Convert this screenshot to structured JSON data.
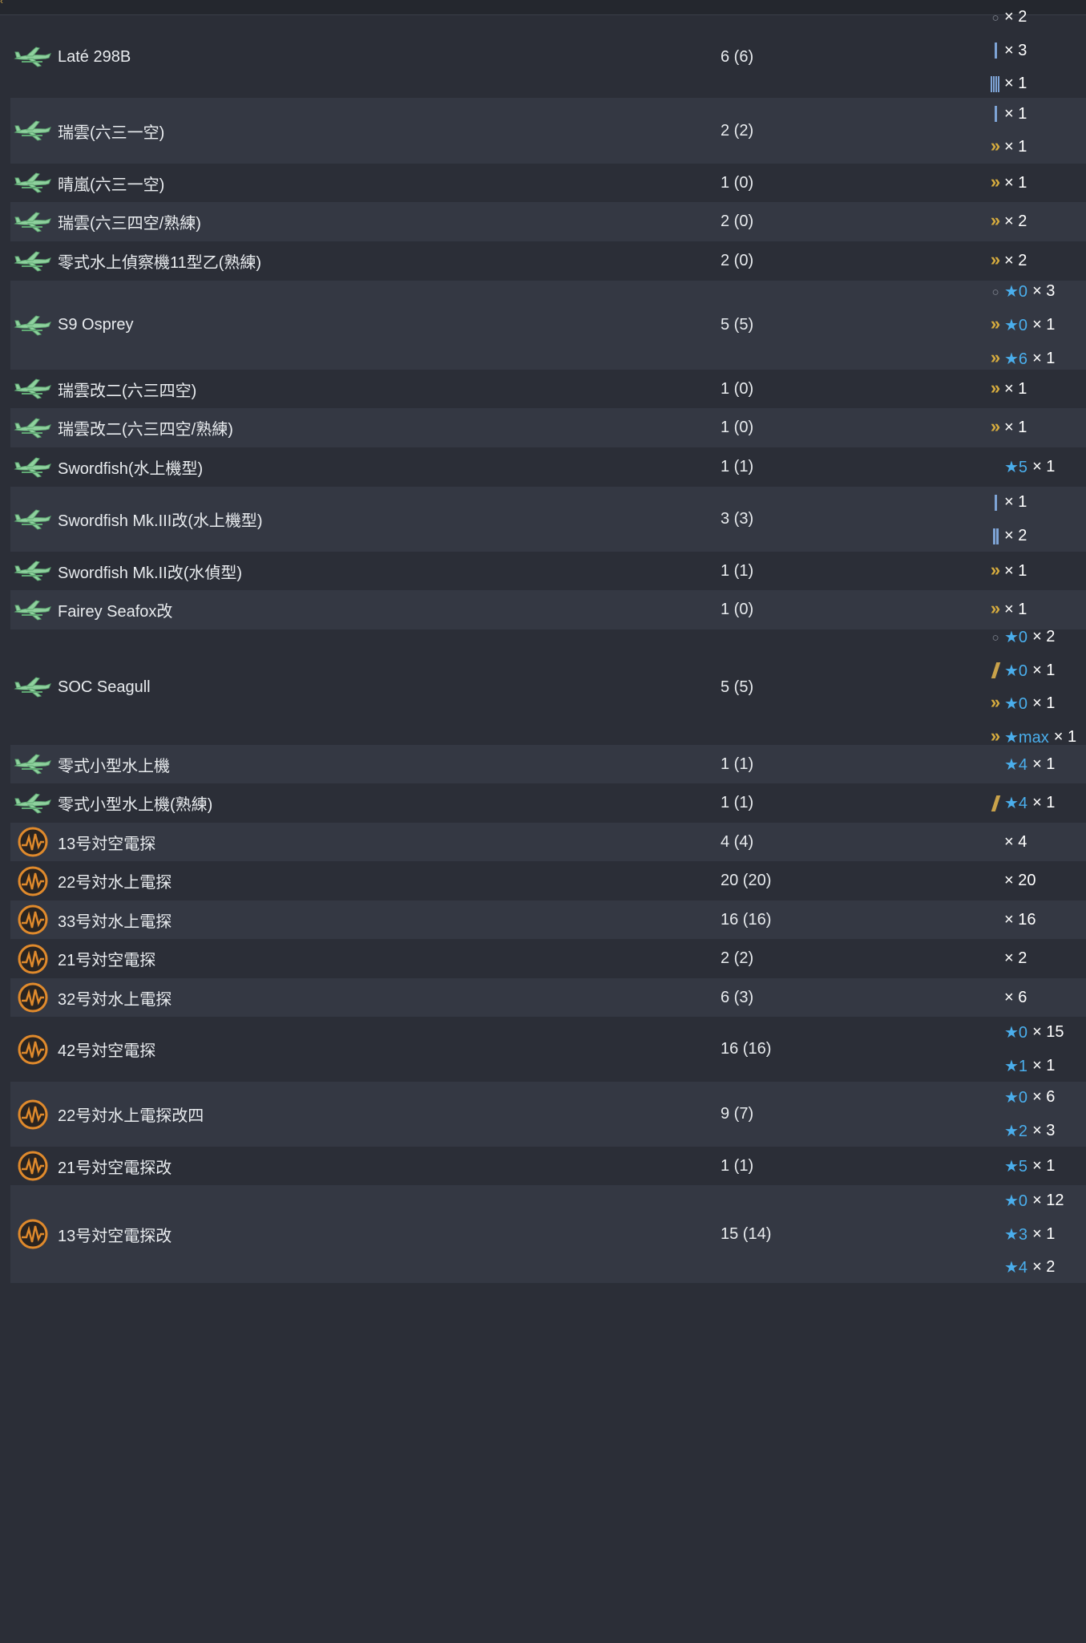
{
  "header": {
    "corner_glyph": "‹"
  },
  "rows": [
    {
      "icon": "seaplane-icon",
      "name": "Laté 298B",
      "count": "6 (6)",
      "height": 0,
      "details": [
        {
          "glyph": "circle",
          "star": "",
          "mult": "× 2"
        },
        {
          "glyph": "bar1",
          "star": "",
          "mult": "× 3"
        },
        {
          "glyph": "bar4",
          "star": "",
          "mult": "× 1"
        }
      ]
    },
    {
      "icon": "seaplane-icon",
      "name": "瑞雲(六三一空)",
      "count": "2 (2)",
      "details": [
        {
          "glyph": "bar1",
          "star": "",
          "mult": "× 1"
        },
        {
          "glyph": "chevron",
          "star": "",
          "mult": "× 1"
        }
      ]
    },
    {
      "icon": "seaplane-icon",
      "name": "晴嵐(六三一空)",
      "count": "1 (0)",
      "details": [
        {
          "glyph": "chevron",
          "star": "",
          "mult": "× 1"
        }
      ]
    },
    {
      "icon": "seaplane-icon",
      "name": "瑞雲(六三四空/熟練)",
      "count": "2 (0)",
      "details": [
        {
          "glyph": "chevron",
          "star": "",
          "mult": "× 2"
        }
      ]
    },
    {
      "icon": "seaplane-icon",
      "name": "零式水上偵察機11型乙(熟練)",
      "count": "2 (0)",
      "details": [
        {
          "glyph": "chevron",
          "star": "",
          "mult": "× 2"
        }
      ]
    },
    {
      "icon": "seaplane-icon",
      "name": "S9 Osprey",
      "count": "5 (5)",
      "details": [
        {
          "glyph": "circle",
          "star": "★0",
          "mult": "× 3"
        },
        {
          "glyph": "chevron",
          "star": "★0",
          "mult": "× 1"
        },
        {
          "glyph": "chevron",
          "star": "★6",
          "mult": "× 1"
        }
      ]
    },
    {
      "icon": "seaplane-icon",
      "name": "瑞雲改二(六三四空)",
      "count": "1 (0)",
      "details": [
        {
          "glyph": "chevron",
          "star": "",
          "mult": "× 1"
        }
      ]
    },
    {
      "icon": "seaplane-icon",
      "name": "瑞雲改二(六三四空/熟練)",
      "count": "1 (0)",
      "details": [
        {
          "glyph": "chevron",
          "star": "",
          "mult": "× 1"
        }
      ]
    },
    {
      "icon": "seaplane-icon",
      "name": "Swordfish(水上機型)",
      "count": "1 (1)",
      "details": [
        {
          "glyph": "",
          "star": "★5",
          "mult": "× 1"
        }
      ]
    },
    {
      "icon": "seaplane-icon",
      "name": "Swordfish Mk.III改(水上機型)",
      "count": "3 (3)",
      "details": [
        {
          "glyph": "bar1",
          "star": "",
          "mult": "× 1"
        },
        {
          "glyph": "bar2",
          "star": "",
          "mult": "× 2"
        }
      ]
    },
    {
      "icon": "seaplane-icon",
      "name": "Swordfish Mk.II改(水偵型)",
      "count": "1 (1)",
      "details": [
        {
          "glyph": "chevron",
          "star": "",
          "mult": "× 1"
        }
      ]
    },
    {
      "icon": "seaplane-icon",
      "name": "Fairey Seafox改",
      "count": "1 (0)",
      "details": [
        {
          "glyph": "chevron",
          "star": "",
          "mult": "× 1"
        }
      ]
    },
    {
      "icon": "seaplane-icon",
      "name": "SOC Seagull",
      "count": "5 (5)",
      "details": [
        {
          "glyph": "circle",
          "star": "★0",
          "mult": "× 2"
        },
        {
          "glyph": "slash",
          "star": "★0",
          "mult": "× 1"
        },
        {
          "glyph": "chevron",
          "star": "★0",
          "mult": "× 1"
        },
        {
          "glyph": "chevron",
          "star": "★max",
          "mult": "× 1"
        }
      ]
    },
    {
      "icon": "seaplane-icon",
      "name": "零式小型水上機",
      "count": "1 (1)",
      "details": [
        {
          "glyph": "",
          "star": "★4",
          "mult": "× 1"
        }
      ]
    },
    {
      "icon": "seaplane-icon",
      "name": "零式小型水上機(熟練)",
      "count": "1 (1)",
      "details": [
        {
          "glyph": "slash",
          "star": "★4",
          "mult": "× 1"
        }
      ]
    },
    {
      "icon": "radar-icon",
      "name": "13号対空電探",
      "count": "4 (4)",
      "details": [
        {
          "glyph": "",
          "star": "",
          "mult": "× 4"
        }
      ]
    },
    {
      "icon": "radar-icon",
      "name": "22号対水上電探",
      "count": "20 (20)",
      "details": [
        {
          "glyph": "",
          "star": "",
          "mult": "× 20"
        }
      ]
    },
    {
      "icon": "radar-icon",
      "name": "33号対水上電探",
      "count": "16 (16)",
      "details": [
        {
          "glyph": "",
          "star": "",
          "mult": "× 16"
        }
      ]
    },
    {
      "icon": "radar-icon",
      "name": "21号対空電探",
      "count": "2 (2)",
      "details": [
        {
          "glyph": "",
          "star": "",
          "mult": "× 2"
        }
      ]
    },
    {
      "icon": "radar-icon",
      "name": "32号対水上電探",
      "count": "6 (3)",
      "details": [
        {
          "glyph": "",
          "star": "",
          "mult": "× 6"
        }
      ]
    },
    {
      "icon": "radar-icon",
      "name": "42号対空電探",
      "count": "16 (16)",
      "details": [
        {
          "glyph": "",
          "star": "★0",
          "mult": "× 15"
        },
        {
          "glyph": "",
          "star": "★1",
          "mult": "× 1"
        }
      ]
    },
    {
      "icon": "radar-icon",
      "name": "22号対水上電探改四",
      "count": "9 (7)",
      "details": [
        {
          "glyph": "",
          "star": "★0",
          "mult": "× 6"
        },
        {
          "glyph": "",
          "star": "★2",
          "mult": "× 3"
        }
      ]
    },
    {
      "icon": "radar-icon",
      "name": "21号対空電探改",
      "count": "1 (1)",
      "details": [
        {
          "glyph": "",
          "star": "★5",
          "mult": "× 1"
        }
      ]
    },
    {
      "icon": "radar-icon",
      "name": "13号対空電探改",
      "count": "15 (14)",
      "details": [
        {
          "glyph": "",
          "star": "★0",
          "mult": "× 12"
        },
        {
          "glyph": "",
          "star": "★3",
          "mult": "× 1"
        },
        {
          "glyph": "",
          "star": "★4",
          "mult": "× 2"
        }
      ]
    }
  ]
}
